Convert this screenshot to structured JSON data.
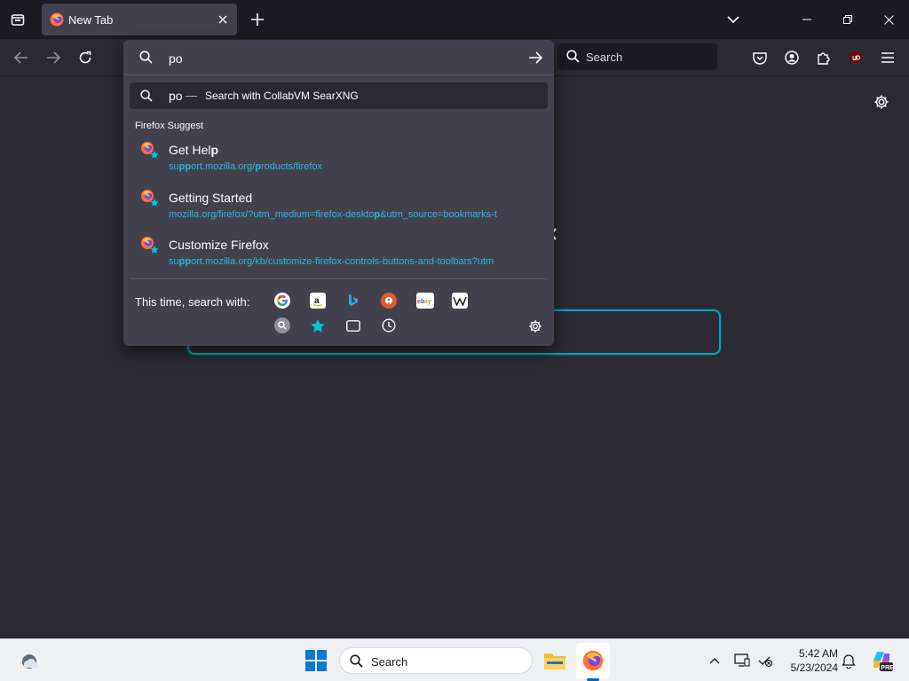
{
  "tab": {
    "title": "New Tab"
  },
  "toolbar": {
    "search_placeholder": "Search"
  },
  "urlbar": {
    "value": "po",
    "heuristic": {
      "query": "po",
      "separator": "—",
      "action": "Search with CollabVM SearXNG"
    },
    "suggest_label": "Firefox Suggest",
    "suggestions": [
      {
        "title_plain": "Get Hel",
        "title_bold": "p",
        "url_parts": [
          [
            "su",
            ""
          ],
          [
            "pp",
            "b"
          ],
          [
            "ort.mozilla.org/",
            ""
          ],
          [
            "p",
            "b"
          ],
          [
            "roducts/firefox",
            ""
          ]
        ]
      },
      {
        "title_plain": "Getting Started",
        "title_bold": "",
        "url_parts": [
          [
            "mozilla.org/firefox/?utm_medium=firefox-deskto",
            ""
          ],
          [
            "p",
            "b"
          ],
          [
            "&utm_source=bookmarks-t",
            ""
          ]
        ]
      },
      {
        "title_plain": "Customize Firefox",
        "title_bold": "",
        "url_parts": [
          [
            "su",
            ""
          ],
          [
            "pp",
            "b"
          ],
          [
            "ort.mozilla.org/kb/customize-firefox-controls-buttons-and-toolbars?utm",
            ""
          ]
        ]
      }
    ],
    "oneoff_label": "This time, search with:",
    "engines": [
      "google-icon",
      "amazon-icon",
      "bing-icon",
      "duckduckgo-icon",
      "ebay-icon",
      "wikipedia-icon"
    ],
    "modes": [
      "searxng-icon",
      "bookmarks-star-icon",
      "tabs-icon",
      "history-icon"
    ]
  },
  "taskbar": {
    "search_placeholder": "Search",
    "time": "5:42 AM",
    "date": "5/23/2024"
  },
  "colors": {
    "accent": "#00a5b8",
    "url": "#26bbe0",
    "popup_bg": "#42414d",
    "content_bg": "#2b2a33"
  }
}
